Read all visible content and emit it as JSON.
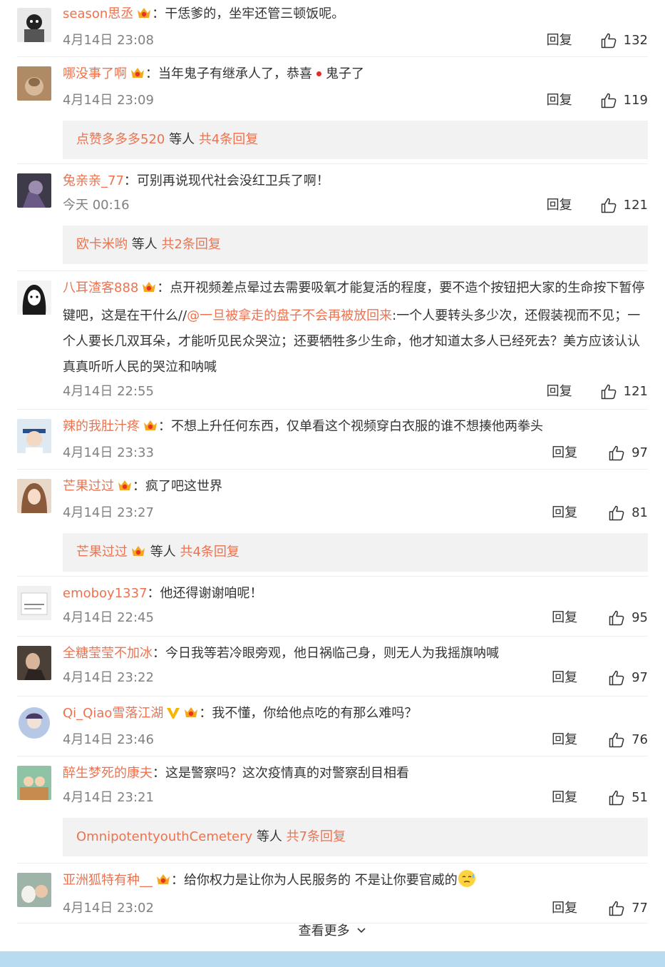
{
  "comments": [
    {
      "user": "season思丞",
      "badge": true,
      "text": "干恁爹的，坐牢还管三顿饭呢。",
      "time": "4月14日 23:08",
      "reply": "回复",
      "likes": "132"
    },
    {
      "user": "哪没事了啊",
      "badge": true,
      "text_a": "当年鬼子有继承人了，恭喜",
      "text_b": "鬼子了",
      "time": "4月14日 23:09",
      "reply": "回复",
      "likes": "119",
      "replies": {
        "names": "点赞多多多520",
        "mid": " 等人 ",
        "count": "共4条回复"
      }
    },
    {
      "user": "兔亲亲_77",
      "badge": false,
      "text": "可别再说现代社会没红卫兵了啊！",
      "time": "今天 00:16",
      "reply": "回复",
      "likes": "121",
      "replies": {
        "names": "欧卡米哟",
        "mid": " 等人 ",
        "count": "共2条回复"
      }
    },
    {
      "user": "八耳渣客888",
      "badge": true,
      "text_a": "点开视频差点晕过去需要吸氧才能复活的程度，要不造个按钮把大家的生命按下暂停键吧，这是在干什么//",
      "mention": "@一旦被拿走的盘子不会再被放回来",
      "text_b": ":一个人要转头多少次，还假装视而不见；一个人要长几双耳朵，才能听见民众哭泣；还要牺牲多少生命，他才知道太多人已经死去？美方应该认认真真听听人民的哭泣和呐喊",
      "time": "4月14日 22:55",
      "reply": "回复",
      "likes": "121"
    },
    {
      "user": "辣的我肚汁疼",
      "badge": true,
      "text": "不想上升任何东西，仅单看这个视频穿白衣服的谁不想揍他两拳头",
      "time": "4月14日 23:33",
      "reply": "回复",
      "likes": "97"
    },
    {
      "user": "芒果过过",
      "badge": true,
      "text": "疯了吧这世界",
      "time": "4月14日 23:27",
      "reply": "回复",
      "likes": "81",
      "replies": {
        "names": "芒果过过",
        "mid": " 等人 ",
        "count": "共4条回复",
        "badge": true
      }
    },
    {
      "user": "emoboy1337",
      "badge": false,
      "text": "他还得谢谢咱呢！",
      "time": "4月14日 22:45",
      "reply": "回复",
      "likes": "95"
    },
    {
      "user": "全糖莹莹不加冰",
      "badge": false,
      "text": "今日我等若冷眼旁观，他日祸临己身，则无人为我摇旗呐喊",
      "time": "4月14日 23:22",
      "reply": "回复",
      "likes": "97"
    },
    {
      "user": "Qi_Qiao雪落江湖",
      "badge": true,
      "vip": true,
      "text": "我不懂，你给他点吃的有那么难吗？",
      "time": "4月14日 23:46",
      "reply": "回复",
      "likes": "76"
    },
    {
      "user": "醉生梦死的康夫",
      "badge": false,
      "text": "这是警察吗？这次疫情真的对警察刮目相看",
      "time": "4月14日 23:21",
      "reply": "回复",
      "likes": "51",
      "replies": {
        "names": "OmnipotentyouthCemetery",
        "mid": " 等人 ",
        "count": "共7条回复"
      }
    },
    {
      "user": "亚洲狐特有种__",
      "badge": true,
      "text": "给你权力是让你为人民服务的 不是让你要官威的",
      "emoji": true,
      "time": "4月14日 23:02",
      "reply": "回复",
      "likes": "77"
    }
  ],
  "colon": "：",
  "more": "查看更多",
  "colors": {
    "accent": "#eb7350",
    "text": "#333333",
    "meta": "#808080",
    "reply_bg": "#f2f2f2",
    "bottom_bar": "#b8dbf2"
  }
}
